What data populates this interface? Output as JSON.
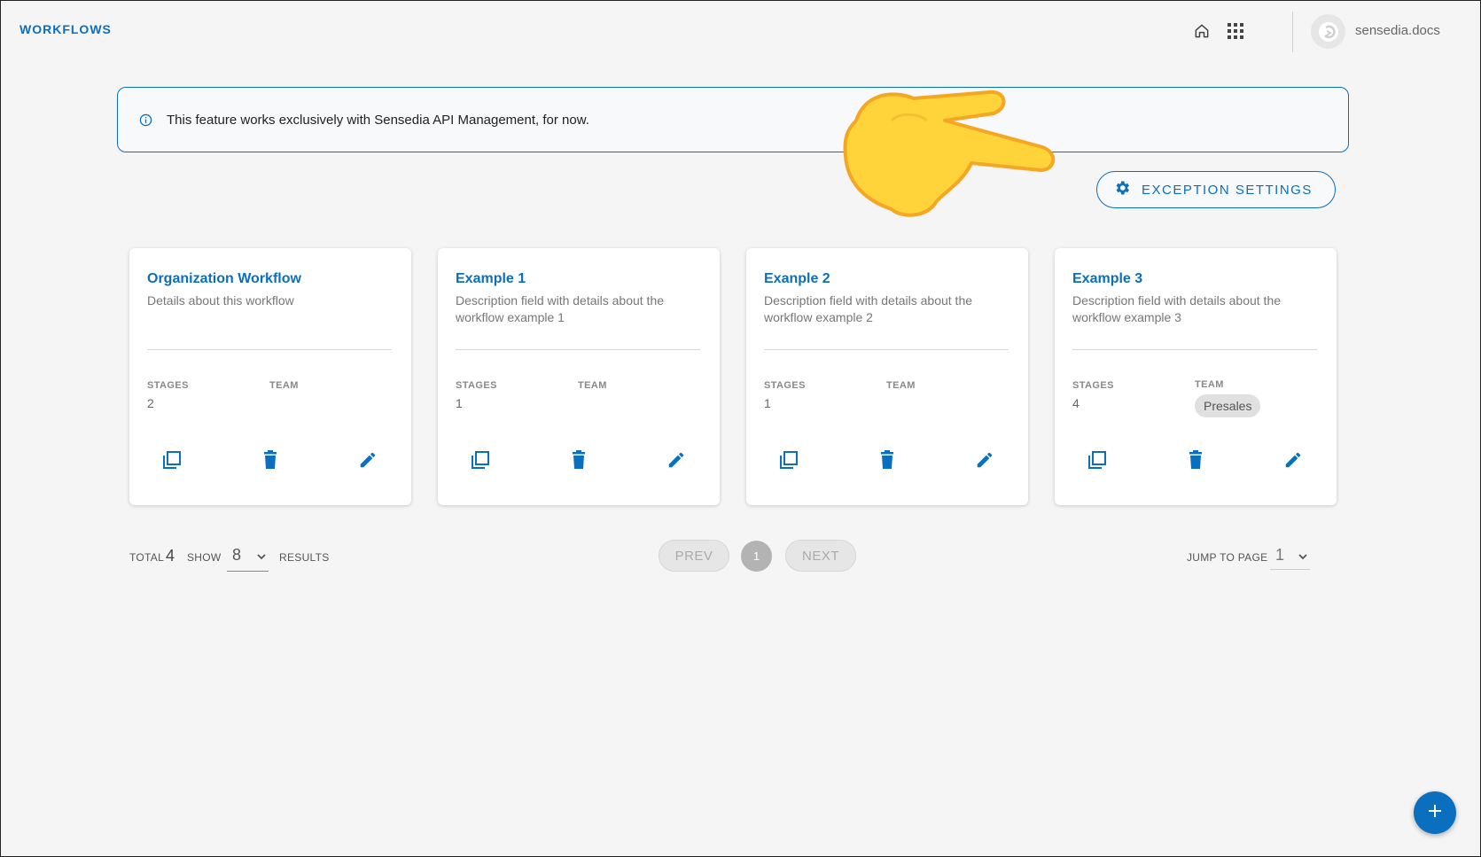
{
  "header": {
    "title": "WORKFLOWS",
    "username": "sensedia.docs",
    "icons": [
      "home-icon",
      "apps-grid-icon",
      "avatar-logo-icon"
    ]
  },
  "banner": {
    "text": "This feature works exclusively with Sensedia API Management, for now.",
    "icon": "info-icon"
  },
  "exception_settings": {
    "label": "EXCEPTION SETTINGS",
    "icon": "gear-icon"
  },
  "cards": [
    {
      "title": "Organization Workflow",
      "description": "Details about this workflow",
      "stages_label": "STAGES",
      "stages": "2",
      "team_label": "TEAM",
      "team": ""
    },
    {
      "title": "Example 1",
      "description": "Description field with details about the workflow example 1",
      "stages_label": "STAGES",
      "stages": "1",
      "team_label": "TEAM",
      "team": ""
    },
    {
      "title": "Exanple 2",
      "description": "Description field with details about the workflow example 2",
      "stages_label": "STAGES",
      "stages": "1",
      "team_label": "TEAM",
      "team": ""
    },
    {
      "title": "Example 3",
      "description": "Description field with details about the workflow example 3",
      "stages_label": "STAGES",
      "stages": "4",
      "team_label": "TEAM",
      "team": "Presales"
    }
  ],
  "card_actions": [
    "copy-icon",
    "trash-icon",
    "pencil-icon"
  ],
  "footer": {
    "total_label": "TOTAL",
    "total": "4",
    "show_label": "SHOW",
    "show_value": "8",
    "results_label": "RESULTS",
    "prev_label": "PREV",
    "current_page": "1",
    "next_label": "NEXT",
    "jump_label": "JUMP TO PAGE",
    "jump_value": "1"
  },
  "fab": {
    "label": "+",
    "icon": "plus-icon"
  },
  "colors": {
    "accent": "#0b6fbf",
    "background": "#f5f5f5",
    "chip": "#e0e0e0",
    "pointer": "#ffd43b"
  }
}
